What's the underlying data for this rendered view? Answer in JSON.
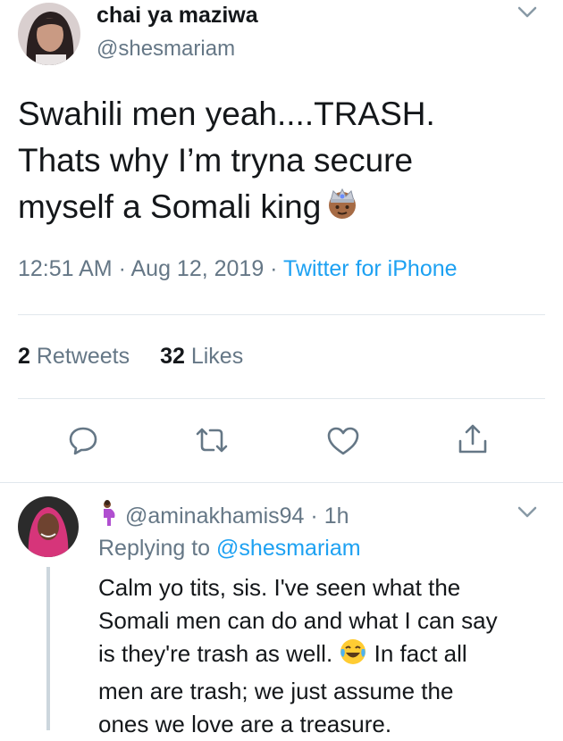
{
  "tweet": {
    "display_name": "chai ya maziwa",
    "handle": "@shesmariam",
    "text_lines": [
      "Swahili men yeah....TRASH.",
      "Thats why I’m tryna secure",
      "myself a Somali king"
    ],
    "emoji": "prince-emoji",
    "time": "12:51 AM",
    "separator": " · ",
    "date": "Aug 12, 2019",
    "source": "Twitter for iPhone",
    "retweets_count": "2",
    "retweets_label": "Retweets",
    "likes_count": "32",
    "likes_label": "Likes"
  },
  "actions": [
    {
      "name": "reply-icon"
    },
    {
      "name": "retweet-icon"
    },
    {
      "name": "like-icon"
    },
    {
      "name": "share-icon"
    }
  ],
  "reply": {
    "handle": "@aminakhamis94",
    "separator": " · ",
    "time": "1h",
    "replying_prefix": "Replying to ",
    "replying_to": "@shesmariam",
    "text_before_emoji": "Calm yo tits, sis. I've seen what the\nSomali men can do and what I can say\nis they're trash as well. ",
    "text_after_emoji": " In fact all\nmen are trash; we just assume the\nones we love are a treasure.",
    "emoji": "tears-of-joy-emoji"
  },
  "colors": {
    "accent": "#1da1f2",
    "secondary_text": "#657786",
    "divider": "#e1e8ed",
    "icon": "#657786"
  }
}
